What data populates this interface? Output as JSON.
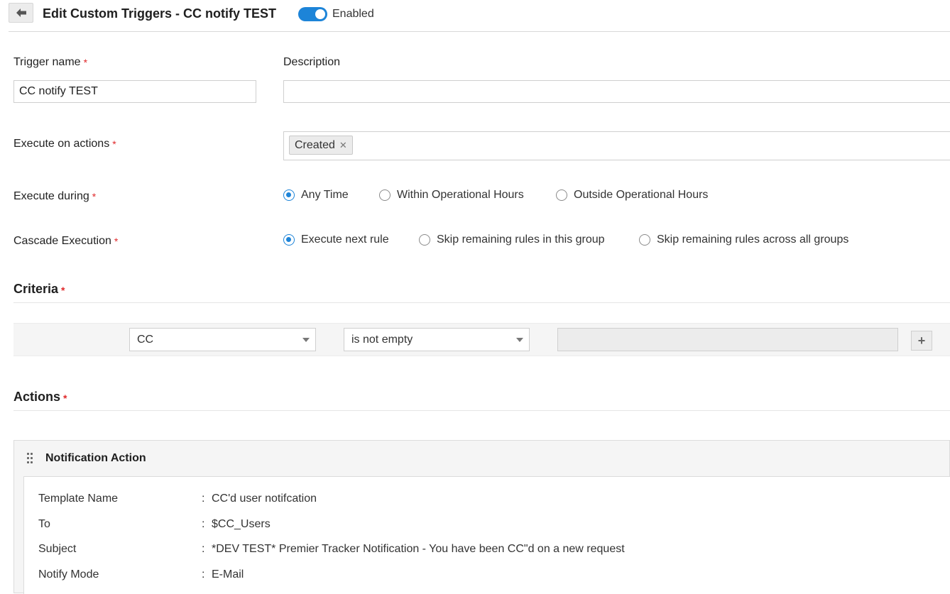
{
  "header": {
    "title": "Edit Custom Triggers - CC notify TEST",
    "enabled_label": "Enabled",
    "enabled": true
  },
  "form": {
    "trigger_name_label": "Trigger name",
    "trigger_name_value": "CC notify TEST",
    "description_label": "Description",
    "description_value": "",
    "execute_on_actions_label": "Execute on actions",
    "execute_on_actions_tags": [
      "Created"
    ],
    "execute_during_label": "Execute during",
    "execute_during_options": [
      "Any Time",
      "Within Operational Hours",
      "Outside Operational Hours"
    ],
    "execute_during_selected": "Any Time",
    "cascade_label": "Cascade Execution",
    "cascade_options": [
      "Execute next rule",
      "Skip remaining rules in this group",
      "Skip remaining rules across all groups"
    ],
    "cascade_selected": "Execute next rule"
  },
  "criteria": {
    "title": "Criteria",
    "field": "CC",
    "operator": "is not empty",
    "value": "",
    "add_symbol": "+"
  },
  "actions": {
    "title": "Actions",
    "card_title": "Notification Action",
    "rows": [
      {
        "key": "Template Name",
        "sep": ":",
        "value": "CC'd user notifcation"
      },
      {
        "key": "To",
        "sep": ":",
        "value": "$CC_Users"
      },
      {
        "key": "Subject",
        "sep": ":",
        "value": "*DEV TEST* Premier Tracker Notification - You have been CC\"d on a new request"
      },
      {
        "key": "Notify Mode",
        "sep": ":",
        "value": "E-Mail"
      }
    ]
  },
  "required_mark": "*",
  "colors": {
    "accent": "#1d84d8",
    "required": "#e0292b"
  }
}
